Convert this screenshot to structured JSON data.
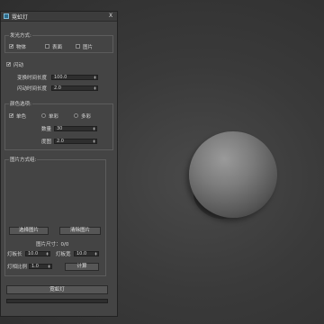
{
  "window": {
    "title": "霓虹灯",
    "close_glyph": "X"
  },
  "emission": {
    "title": "发光方式:",
    "options": [
      {
        "label": "物体",
        "checked": true
      },
      {
        "label": "表面",
        "checked": false
      },
      {
        "label": "图片",
        "checked": false
      }
    ]
  },
  "flash": {
    "label": "闪动",
    "checked": true,
    "transform_time_label": "变换时间长度",
    "transform_time_value": "100.0",
    "flash_time_label": "闪动时间长度",
    "flash_time_value": "2.0"
  },
  "color": {
    "title": "颜色选项:",
    "modes": [
      {
        "label": "单色",
        "checked": true
      },
      {
        "label": "单彩",
        "checked": false
      },
      {
        "label": "多彩",
        "checked": false
      }
    ],
    "count_label": "数量",
    "count_value": "30",
    "degree_label": "度图",
    "degree_value": "2.0"
  },
  "image": {
    "title": "图片方式组:",
    "select_button": "选择图片",
    "remove_button": "清除图片",
    "size_text": "图片尺寸：0/0",
    "lamp_length_label": "灯板长",
    "lamp_length_value": "10.0",
    "lamp_width_label": "灯板宽",
    "lamp_width_value": "10.0",
    "lamp_ratio_label": "灯相比例",
    "lamp_ratio_value": "1.0",
    "calc_button": "计算"
  },
  "footer": {
    "main_button": "霓虹灯"
  },
  "colors": {
    "panel": "#444444",
    "viewport": "#3a3a3a",
    "sphere": "#7c7c7c"
  }
}
